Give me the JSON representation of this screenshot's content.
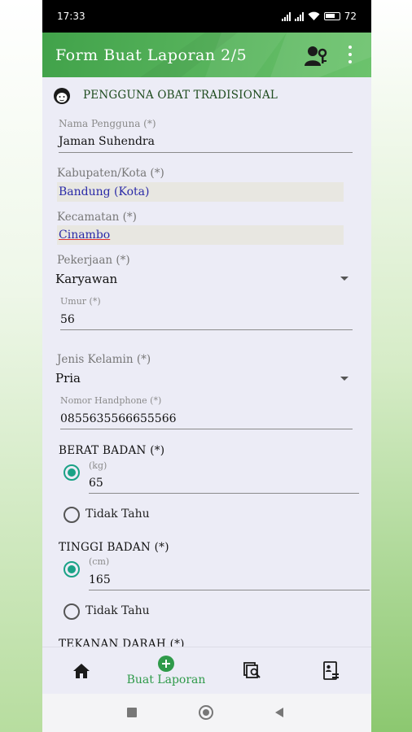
{
  "status": {
    "time": "17:33",
    "battery": "72"
  },
  "appbar": {
    "title": "Form Buat Laporan 2/5",
    "user_icon": "person-key-icon",
    "more_icon": "more-vert-icon"
  },
  "section": {
    "icon": "user-avatar-icon",
    "title": "PENGGUNA OBAT TRADISIONAL"
  },
  "fields": {
    "nama": {
      "label": "Nama Pengguna (*)",
      "value": "Jaman Suhendra"
    },
    "kabupaten": {
      "label": "Kabupaten/Kota (*)",
      "value": "Bandung (Kota)"
    },
    "kecamatan": {
      "label": "Kecamatan (*)",
      "value": "Cinambo"
    },
    "pekerjaan": {
      "label": "Pekerjaan (*)",
      "value": "Karyawan"
    },
    "umur": {
      "label": "Umur (*)",
      "value": "56"
    },
    "jenis_kelamin": {
      "label": "Jenis Kelamin (*)",
      "value": "Pria"
    },
    "nomor_hp": {
      "label": "Nomor Handphone (*)",
      "value": "0855635566655566"
    }
  },
  "berat": {
    "title": "BERAT BADAN (*)",
    "unit": "(kg)",
    "value": "65",
    "unknown": "Tidak Tahu",
    "selected": "value"
  },
  "tinggi": {
    "title": "TINGGI BADAN (*)",
    "unit": "(cm)",
    "value": "165",
    "unknown": "Tidak Tahu",
    "selected": "value"
  },
  "tekanan": {
    "title": "TEKANAN DARAH (*)"
  },
  "nav": {
    "home_icon": "home-icon",
    "buat_label": "Buat Laporan",
    "buat_icon": "add-circle-icon",
    "search_icon": "search-docs-icon",
    "profile_icon": "profile-doc-icon"
  },
  "colors": {
    "appbar": "#4caf50",
    "accent": "#1aa286",
    "nav_active": "#2f9a4a"
  }
}
